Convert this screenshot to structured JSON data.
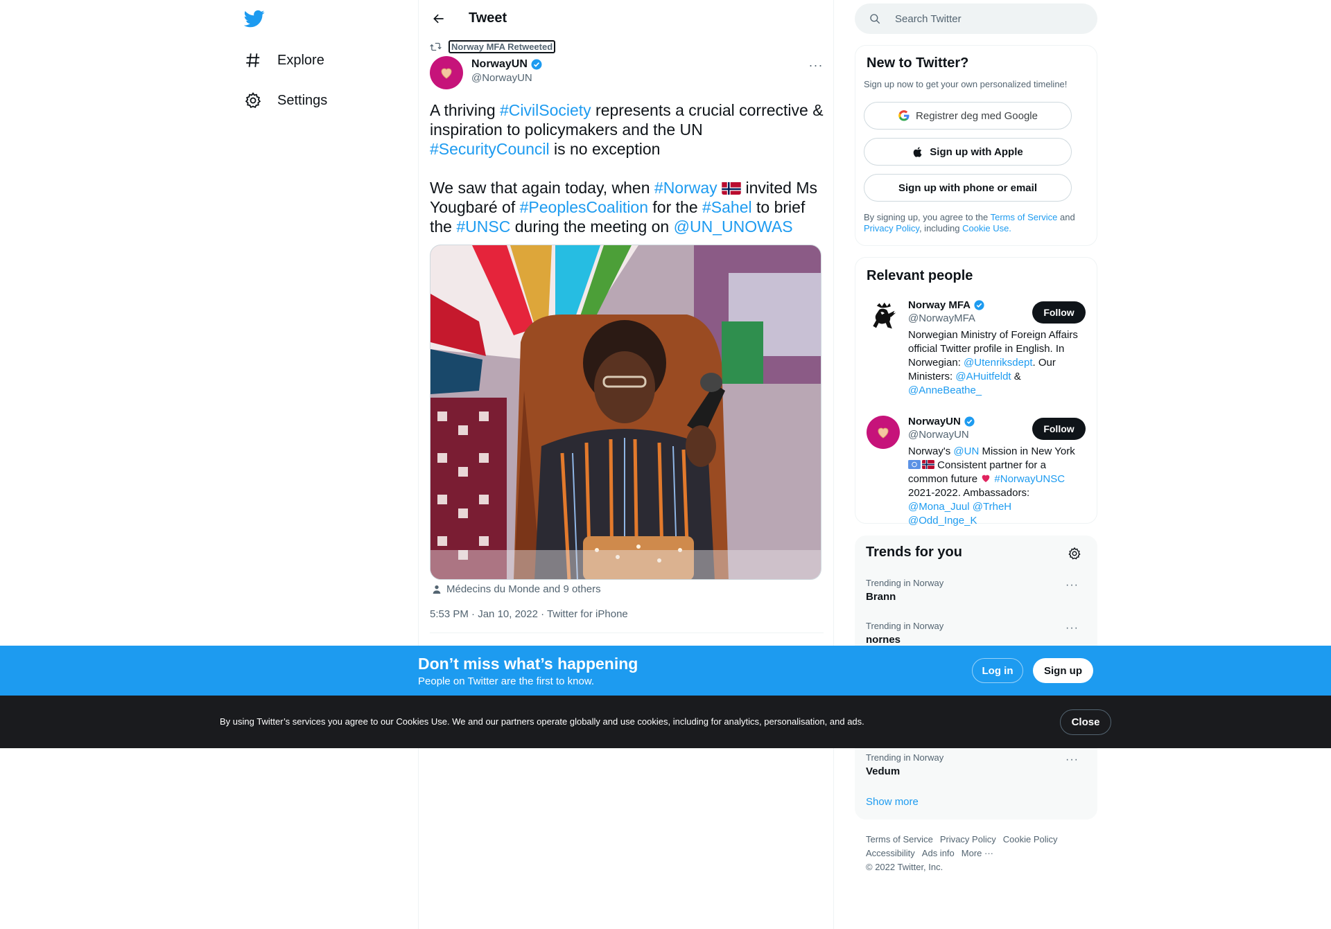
{
  "nav": {
    "items": [
      {
        "label": "Explore",
        "icon": "hashtag-icon"
      },
      {
        "label": "Settings",
        "icon": "gear-icon"
      }
    ]
  },
  "main": {
    "title": "Tweet",
    "retweeted_by": "Norway MFA Retweeted",
    "author": {
      "name": "NorwayUN",
      "handle": "@NorwayUN"
    },
    "tweet": {
      "p1": {
        "t1": "A thriving ",
        "h1": "#CivilSociety",
        "t2": " represents a crucial corrective & inspiration to policymakers and the UN ",
        "h2": "#SecurityCouncil",
        "t3": " is no exception"
      },
      "p2": {
        "t1": "We saw that again today, when ",
        "h1": "#Norway",
        "t2": " invited Ms Yougbaré of ",
        "h2": "#PeoplesCoalition",
        "t3": " for the ",
        "h3": "#Sahel",
        "t4": " to brief the ",
        "h4": "#UNSC",
        "t5": " during the meeting on ",
        "m1": "@UN_UNOWAS"
      }
    },
    "tagged": "Médecins du Monde and 9 others",
    "time": "5:53 PM",
    "date": "Jan 10, 2022",
    "source": "Twitter for iPhone"
  },
  "search": {
    "placeholder": "Search Twitter"
  },
  "new_to_twitter": {
    "title": "New to Twitter?",
    "subtitle": "Sign up now to get your own personalized timeline!",
    "google_label": "Registrer deg med Google",
    "apple_label": "Sign up with Apple",
    "phone_label": "Sign up with phone or email",
    "legal": {
      "t1": "By signing up, you agree to the ",
      "terms": "Terms of Service",
      "t2": " and ",
      "privacy": "Privacy Policy",
      "t3": ", including ",
      "cookie": "Cookie Use."
    }
  },
  "relevant_people": {
    "title": "Relevant people",
    "people": [
      {
        "name": "Norway MFA",
        "handle": "@NorwayMFA",
        "follow_label": "Follow",
        "bio": {
          "t1": "Norwegian Ministry of Foreign Affairs official Twitter profile in English. In Norwegian: ",
          "m1": "@Utenriksdept",
          "t2": ". Our Ministers: ",
          "m2": "@AHuitfeldt",
          "t3": " & ",
          "m3": "@AnneBeathe_"
        }
      },
      {
        "name": "NorwayUN",
        "handle": "@NorwayUN",
        "follow_label": "Follow",
        "bio": {
          "t1": "Norway's ",
          "m1": "@UN",
          "t2": " Mission in New York ",
          "t3": " Consistent partner for a common future ",
          "h1": "#NorwayUNSC",
          "t4": " 2021-2022. Ambassadors: ",
          "m2": "@Mona_Juul",
          "m3": "@TrheH",
          "m4": "@Odd_Inge_K"
        }
      }
    ]
  },
  "trends": {
    "title": "Trends for you",
    "items": [
      {
        "context": "Trending in Norway",
        "name": "Brann"
      },
      {
        "context": "Trending in Norway",
        "name": "nornes"
      },
      {
        "context": "Trending in Norway",
        "name": "Vedum"
      }
    ],
    "show_more": "Show more"
  },
  "footer": {
    "links": [
      "Terms of Service",
      "Privacy Policy",
      "Cookie Policy",
      "Accessibility",
      "Ads info",
      "More ···"
    ],
    "copyright": "© 2022 Twitter, Inc."
  },
  "signup_bar": {
    "title": "Don’t miss what’s happening",
    "subtitle": "People on Twitter are the first to know.",
    "login_label": "Log in",
    "signup_label": "Sign up"
  },
  "cookie_bar": {
    "text": "By using Twitter’s services you agree to our Cookies Use. We and our partners operate globally and use cookies, including for analytics, personalisation, and ads.",
    "close_label": "Close"
  },
  "colors": {
    "accent": "#1d9bf0",
    "text": "#0f1419",
    "muted": "#536471",
    "avatar": "#c6137a",
    "cookie_bg": "#1a1b1e"
  }
}
